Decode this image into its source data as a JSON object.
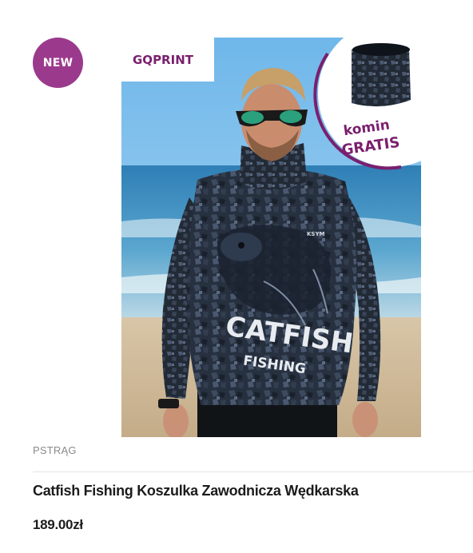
{
  "product": {
    "badge": "NEW",
    "image": {
      "brand_logo": "GQPRINT",
      "promo_line1": "komin",
      "promo_line2": "GRATIS",
      "shirt_text_line1": "CATFISH",
      "shirt_text_line2": "FISHING",
      "shirt_small_text": "KSYM"
    },
    "category": "PSTRĄG",
    "title": "Catfish Fishing Koszulka Zawodnicza Wędkarska",
    "price": "189.00zł"
  },
  "colors": {
    "badge_bg": "#9b3a8d",
    "promo_accent": "#7a1f6e",
    "text_dark": "#1c1c1c",
    "text_muted": "#8a8a8a"
  }
}
